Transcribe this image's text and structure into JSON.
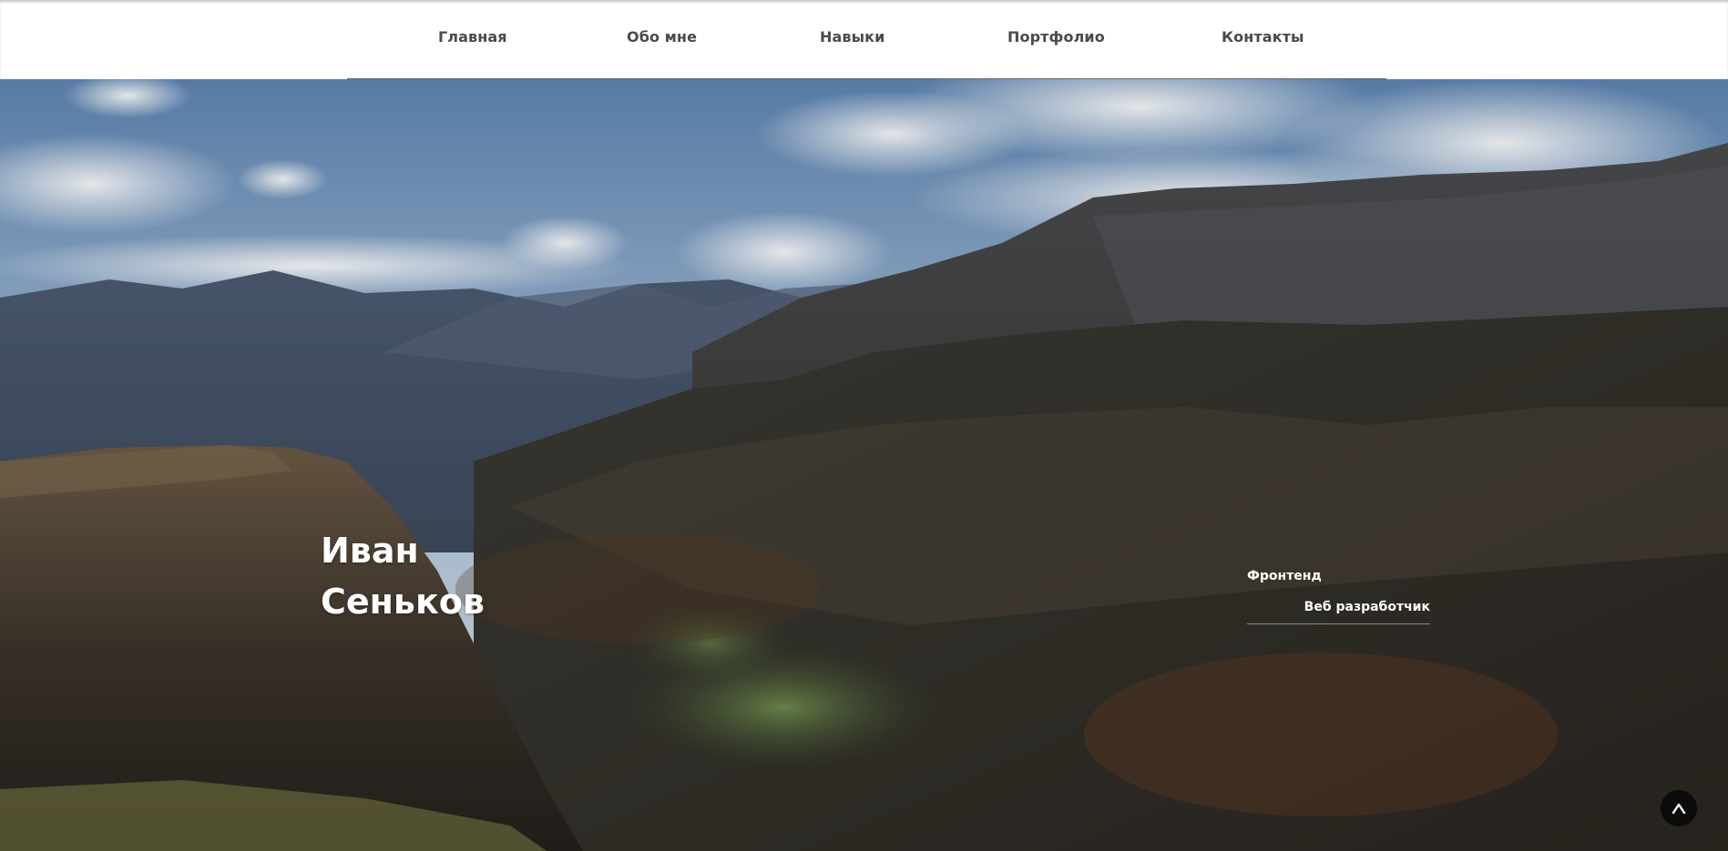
{
  "nav": {
    "items": [
      {
        "label": "Главная"
      },
      {
        "label": "Обо мне"
      },
      {
        "label": "Навыки"
      },
      {
        "label": "Портфолио"
      },
      {
        "label": "Контакты"
      }
    ]
  },
  "hero": {
    "name_first": "Иван",
    "name_last": "Сеньков",
    "role_line1": "Фронтенд",
    "role_line2": "Веб разработчик"
  },
  "scroll_top": {
    "icon": "chevron-up-icon",
    "symbol": "^"
  },
  "colors": {
    "nav_text": "#4a4a4a",
    "nav_divider": "#6b6b6b",
    "hero_text": "#ffffff",
    "scroll_button": "#0b0b0b"
  }
}
